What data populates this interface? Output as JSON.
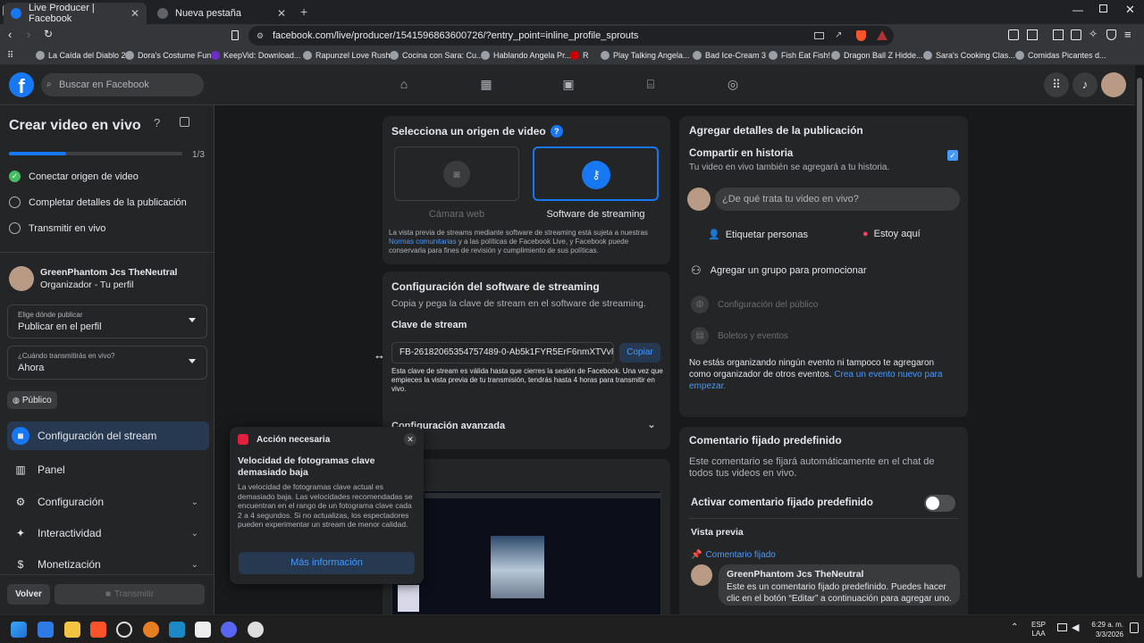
{
  "browser": {
    "tabs": [
      {
        "label": "Live Producer | Facebook",
        "active": true
      },
      {
        "label": "Nueva pestaña",
        "active": false
      }
    ],
    "url": "facebook.com/live/producer/1541596863600726/?entry_point=inline_profile_sprouts",
    "bookmarks": [
      "La Caída del Diablo 2",
      "Dora's Costume Fun",
      "KeepVid: Download...",
      "Rapunzel Love Rush",
      "Cocina con Sara: Cu...",
      "Hablando Angela Pr...",
      "Play Talking Angela...",
      "Bad Ice-Cream 3",
      "Fish Eat Fish!",
      "Dragon Ball Z Hidde...",
      "Sara's Cooking Clas...",
      "Comidas Picantes d..."
    ],
    "bookmark_short": "R"
  },
  "fb": {
    "search_placeholder": "Buscar en Facebook",
    "logo": "f"
  },
  "sidebar": {
    "title": "Crear video en vivo",
    "progress_text": "1/3",
    "progress": 0.33,
    "steps": [
      "Conectar origen de video",
      "Completar detalles de la publicación",
      "Transmitir en vivo"
    ],
    "profile_name": "GreenPhantom Jcs TheNeutral",
    "profile_role": "Organizador - Tu perfil",
    "where_label": "Elige dónde publicar",
    "where_value": "Publicar en el perfil",
    "when_label": "¿Cuándo transmitirás en vivo?",
    "when_value": "Ahora",
    "audience": "Público",
    "menu": [
      "Configuración del stream",
      "Panel",
      "Configuración",
      "Interactividad",
      "Monetización"
    ],
    "back": "Volver",
    "broadcast": "Transmitir"
  },
  "source": {
    "title": "Selecciona un origen de video",
    "options": [
      "Cámara web",
      "Software de streaming"
    ],
    "note_1": "La vista previa de streams mediante software de streaming está sujeta a nuestras",
    "note_link": "Normas comunitarias",
    "note_2": "y a las políticas de Facebook Live, y Facebook puede conservarla para fines de revisión y cumplimiento de sus políticas."
  },
  "software": {
    "title": "Configuración del software de streaming",
    "subtitle": "Copia y pega la clave de stream en el software de streaming.",
    "key_label": "Clave de stream",
    "key_value": "FB-26182065354757489-0-Ab5k1FYR5ErF6nmXTVvF",
    "copy": "Copiar",
    "note": "Esta clave de stream es válida hasta que cierres la sesión de Facebook. Una vez que empieces la vista previa de tu transmisión, tendrás hasta 4 horas para transmitir en vivo.",
    "advanced": "Configuración avanzada"
  },
  "popup": {
    "header": "Acción necesaria",
    "title": "Velocidad de fotogramas clave demasiado baja",
    "body": "La velocidad de fotogramas clave actual es demasiado baja. Las velocidades recomendadas se encuentran en el rango de un fotograma clave cada 2 a 4 segundos. Si no actualizas, los espectadores pueden experimentar un stream de menor calidad.",
    "button": "Más información"
  },
  "details": {
    "title": "Agregar detalles de la publicación",
    "story_title": "Compartir en historia",
    "story_sub": "Tu video en vivo también se agregará a tu historia.",
    "post_placeholder": "¿De qué trata tu video en vivo?",
    "tag": "Etiquetar personas",
    "here": "Estoy aquí",
    "group": "Agregar un grupo para promocionar",
    "audience": "Configuración del público",
    "tickets": "Boletos y eventos",
    "events_text": "No estás organizando ningún evento ni tampoco te agregaron como organizador de otros eventos.",
    "events_link": "Crea un evento nuevo para empezar."
  },
  "comment": {
    "title": "Comentario fijado predefinido",
    "desc": "Este comentario se fijará automáticamente en el chat de todos tus videos en vivo.",
    "toggle_label": "Activar comentario fijado predefinido",
    "preview": "Vista previa",
    "pinned": "Comentario fijado",
    "author": "GreenPhantom Jcs TheNeutral",
    "text": "Este es un comentario fijado predefinido. Puedes hacer clic en el botón “Editar” a continuación para agregar uno."
  },
  "taskbar": {
    "lang": "ESP",
    "lang2": "LAA",
    "time": "6:29 a. m.",
    "date": "3/3/2026"
  },
  "colors": {
    "accent": "#1877f2",
    "link": "#4599ff",
    "bg": "#18191a",
    "card": "#242526"
  }
}
